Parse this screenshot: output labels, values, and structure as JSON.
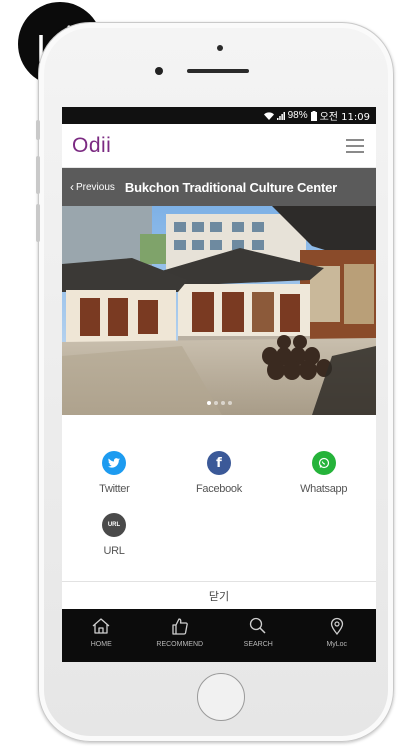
{
  "status": {
    "battery_pct": "98%",
    "time": "오전 11:09"
  },
  "app": {
    "logo": "Odii"
  },
  "nav": {
    "prev_label": "Previous",
    "title": "Bukchon Traditional Culture Center"
  },
  "hero": {
    "slide_count": 4,
    "active_slide": 1
  },
  "share": {
    "items": [
      {
        "label": "Twitter",
        "icon": "twitter-icon",
        "color": "#1d9bf0"
      },
      {
        "label": "Facebook",
        "icon": "facebook-icon",
        "color": "#3b5998"
      },
      {
        "label": "Whatsapp",
        "icon": "whatsapp-icon",
        "color": "#25b33a"
      },
      {
        "label": "URL",
        "icon": "url-icon",
        "color": "#4a4a4a",
        "badge_text": "URL"
      }
    ],
    "close_label": "닫기"
  },
  "tabbar": {
    "tabs": [
      {
        "label": "HOME",
        "icon": "home-icon"
      },
      {
        "label": "RECOMMEND",
        "icon": "thumbs-up-icon"
      },
      {
        "label": "SEARCH",
        "icon": "search-icon"
      },
      {
        "label": "MyLoc",
        "icon": "location-pin-icon"
      }
    ]
  },
  "colors": {
    "brand": "#7b2a82",
    "titlebar": "#5b5b5b",
    "tabbar": "#0c0c0c"
  }
}
